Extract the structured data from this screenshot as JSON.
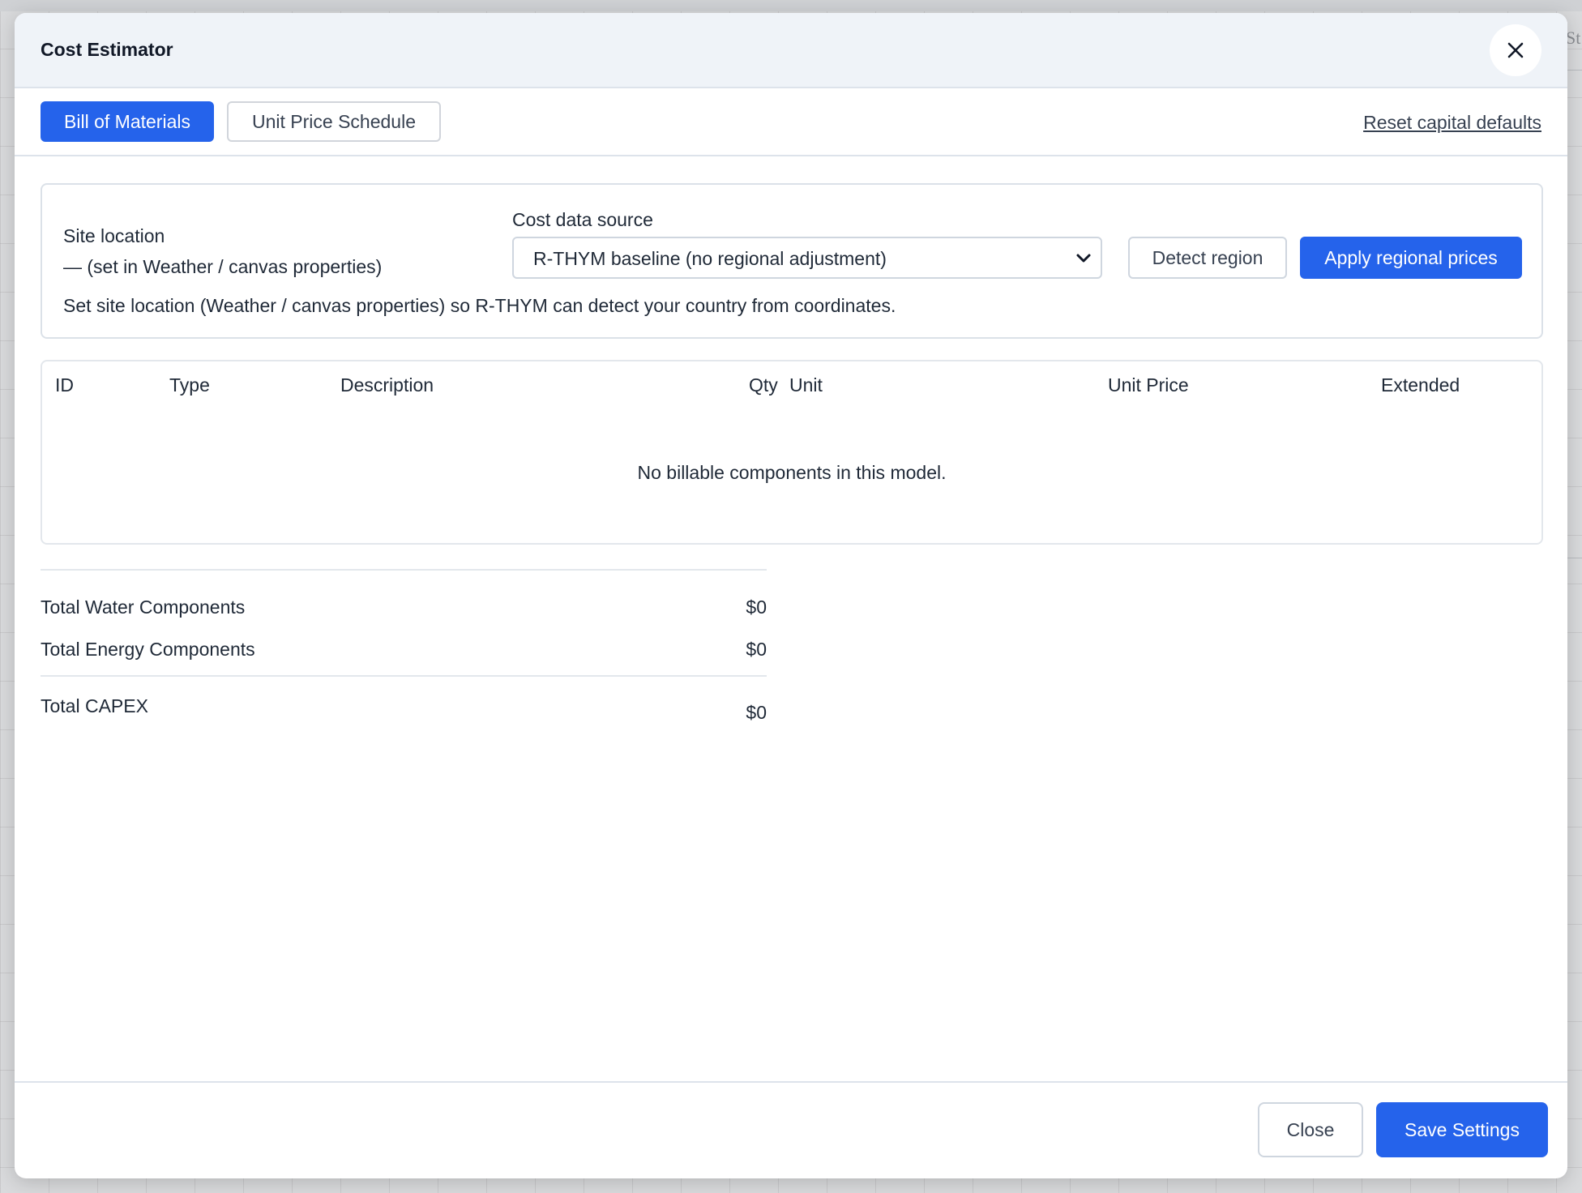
{
  "background": {
    "right_edge_text": "St"
  },
  "modal": {
    "title": "Cost Estimator",
    "close_icon": "close-icon"
  },
  "tabs": [
    {
      "label": "Bill of Materials",
      "active": true
    },
    {
      "label": "Unit Price Schedule",
      "active": false
    }
  ],
  "reset_link": "Reset capital defaults",
  "region": {
    "site_label": "Site location",
    "site_value": "— (set in Weather / canvas properties)",
    "cost_source_label": "Cost data source",
    "cost_source_selected": "R-THYM baseline (no regional adjustment)",
    "detect_button": "Detect region",
    "apply_button": "Apply regional prices",
    "hint": "Set site location (Weather / canvas properties) so R-THYM can detect your country from coordinates."
  },
  "table": {
    "headers": {
      "id": "ID",
      "type": "Type",
      "description": "Description",
      "qty": "Qty",
      "unit": "Unit",
      "unit_price": "Unit Price",
      "extended": "Extended"
    },
    "empty_message": "No billable components in this model."
  },
  "totals": {
    "water_label": "Total Water Components",
    "water_value": "$0",
    "energy_label": "Total Energy Components",
    "energy_value": "$0",
    "capex_label": "Total CAPEX",
    "capex_value": "$0"
  },
  "footer": {
    "close_button": "Close",
    "save_button": "Save Settings"
  },
  "colors": {
    "accent": "#2563eb",
    "header_bg": "#eff3f8"
  }
}
